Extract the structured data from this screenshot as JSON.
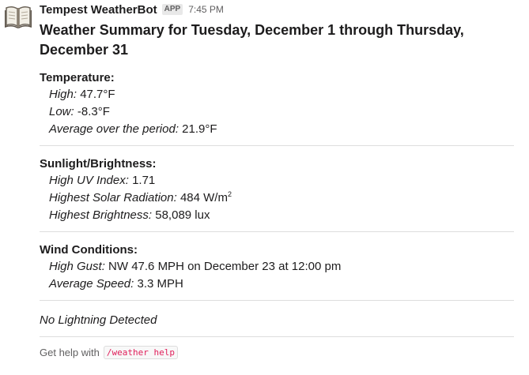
{
  "message": {
    "sender": "Tempest WeatherBot",
    "badge": "APP",
    "time": "7:45 PM",
    "title": "Weather Summary for Tuesday, December 1 through Thursday, December 31"
  },
  "temperature": {
    "heading": "Temperature:",
    "high_label": "High:",
    "high_value": "47.7°F",
    "low_label": "Low:",
    "low_value": "-8.3°F",
    "avg_label": "Average over the period:",
    "avg_value": "21.9°F"
  },
  "sunlight": {
    "heading": "Sunlight/Brightness:",
    "uv_label": "High UV Index:",
    "uv_value": "1.71",
    "solar_label": "Highest Solar Radiation:",
    "solar_value": "484 W/m",
    "solar_sup": "2",
    "bright_label": "Highest Brightness:",
    "bright_value": "58,089 lux"
  },
  "wind": {
    "heading": "Wind Conditions:",
    "gust_label": "High Gust:",
    "gust_value": "NW 47.6 MPH on December 23 at 12:00 pm",
    "speed_label": "Average Speed:",
    "speed_value": "3.3 MPH"
  },
  "lightning": "No Lightning Detected",
  "help": {
    "prefix": "Get help with",
    "command": "/weather help"
  },
  "icons": {
    "avatar": "open-book-icon"
  },
  "colors": {
    "code_text": "#e01e5a",
    "divider": "#dddddd",
    "muted": "#616061"
  }
}
